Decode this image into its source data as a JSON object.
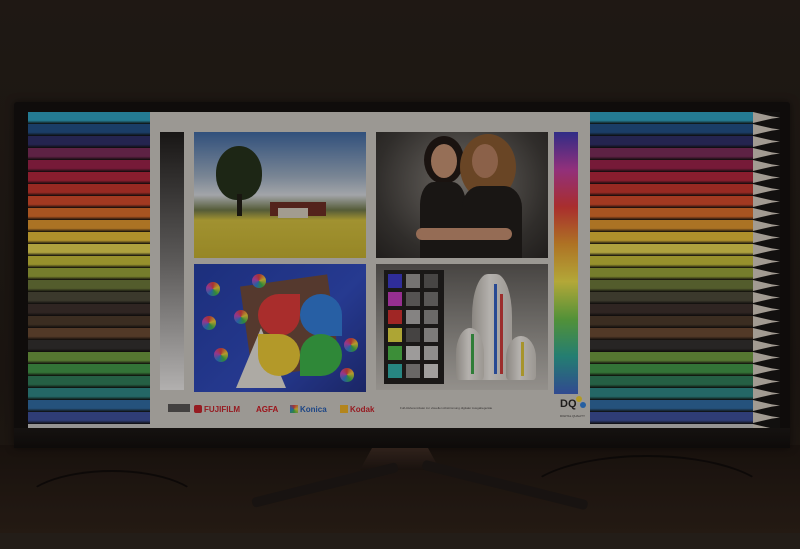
{
  "logos": {
    "fujifilm": "FUJIFILM",
    "agfa": "AGFA",
    "konica": "Konica",
    "kodak": "Kodak"
  },
  "footer_text": "Fuß-Referenzdatei zur visuellen Abstimmung digitaler Ausgabegeräte",
  "dq_logo": {
    "mark": "DQ",
    "sub": "DIGITAL QUALITY"
  },
  "colors": {
    "pencils": [
      "#2aa6c8",
      "#1d4f8a",
      "#2a2d6a",
      "#7b2a5a",
      "#9c1f4a",
      "#b8233c",
      "#c9342c",
      "#d84a2a",
      "#e0702a",
      "#e59a2e",
      "#eac238",
      "#e9da52",
      "#c9c23a",
      "#9aa83a",
      "#6b7a3a",
      "#4a4a3a",
      "#3a2f2c",
      "#4a3a2a",
      "#6a4a32",
      "#2f2f2f",
      "#6ea040",
      "#3f9a48",
      "#2b7f5a",
      "#2a8a8a",
      "#2b6ca8",
      "#3a4fa0",
      "#c8c8c8"
    ],
    "swatches": [
      "#3a3ad0",
      "#9a9a9a",
      "#c83cc4",
      "#6e6e6e",
      "#d63030",
      "#b0b0b0",
      "#e8e044",
      "#585858",
      "#4cc04a",
      "#d2d2d2",
      "#2fb5b0",
      "#8a8a8a"
    ],
    "konica_blue": "#1f5bb5",
    "kodak_yellow": "#f0b323",
    "fujifilm_red": "#c8202a",
    "agfa_red": "#d0141f"
  }
}
